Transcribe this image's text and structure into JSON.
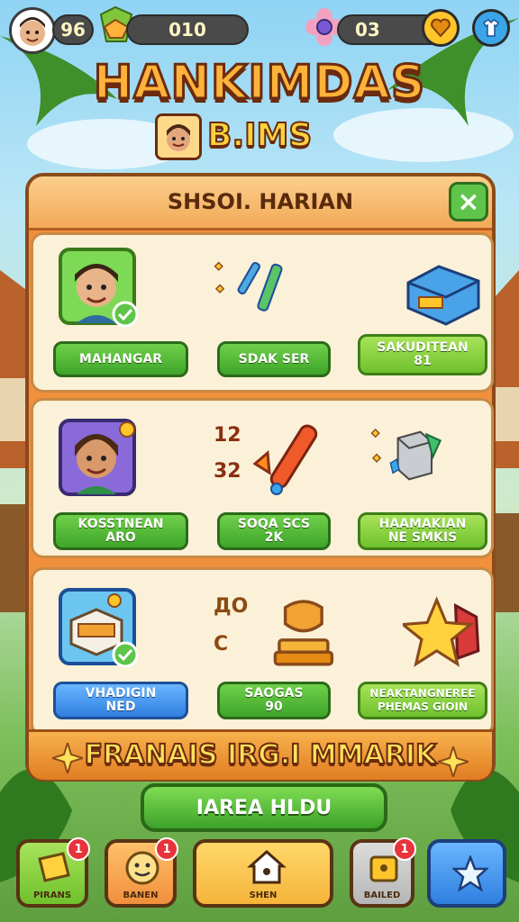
{
  "hud": {
    "level": "96",
    "gems": "010",
    "coins": "03"
  },
  "title": "HANKIMDAS",
  "subtitle": "B.IMS",
  "panel": {
    "title": "SHSOI. HARIAN",
    "close_label": "×",
    "rows": [
      {
        "items": [
          {
            "label": "MAHANGAR",
            "sub": ""
          },
          {
            "label": "SDAK SER",
            "sub": ""
          },
          {
            "label": "SAKUDITEAN",
            "sub": "81"
          }
        ]
      },
      {
        "items": [
          {
            "label": "KOSSTNEAN",
            "sub": "ARO"
          },
          {
            "label": "SOQA SCS",
            "sub": "2K"
          },
          {
            "label": "HAAMAKIAN",
            "sub": "NE SMKIS"
          }
        ]
      },
      {
        "items": [
          {
            "label": "VHADIGIN",
            "sub": "NED"
          },
          {
            "label": "SAOGAS",
            "sub": "90"
          },
          {
            "label": "NEAKTANGNEREE",
            "sub": "PHEMAS GIOIN"
          }
        ]
      }
    ],
    "side_labels": {
      "row1": [
        "",
        ""
      ],
      "row2": [
        "12",
        "32"
      ],
      "row3": [
        "ДО",
        "С"
      ]
    },
    "banner": "FRANAIS IRG.I MMARIK"
  },
  "claim_button": "IAREA HLDU",
  "nav": [
    {
      "label": "PIRANS",
      "badge": "1"
    },
    {
      "label": "BANEN",
      "badge": "1"
    },
    {
      "label": "SHEN",
      "badge": ""
    },
    {
      "label": "BAILED",
      "badge": "1"
    },
    {
      "label": "",
      "badge": ""
    }
  ],
  "colors": {
    "panel_orange": "#f08f3c",
    "button_green": "#3ea52a",
    "button_blue": "#2f7fe0",
    "title_gold": "#ffb23a"
  }
}
